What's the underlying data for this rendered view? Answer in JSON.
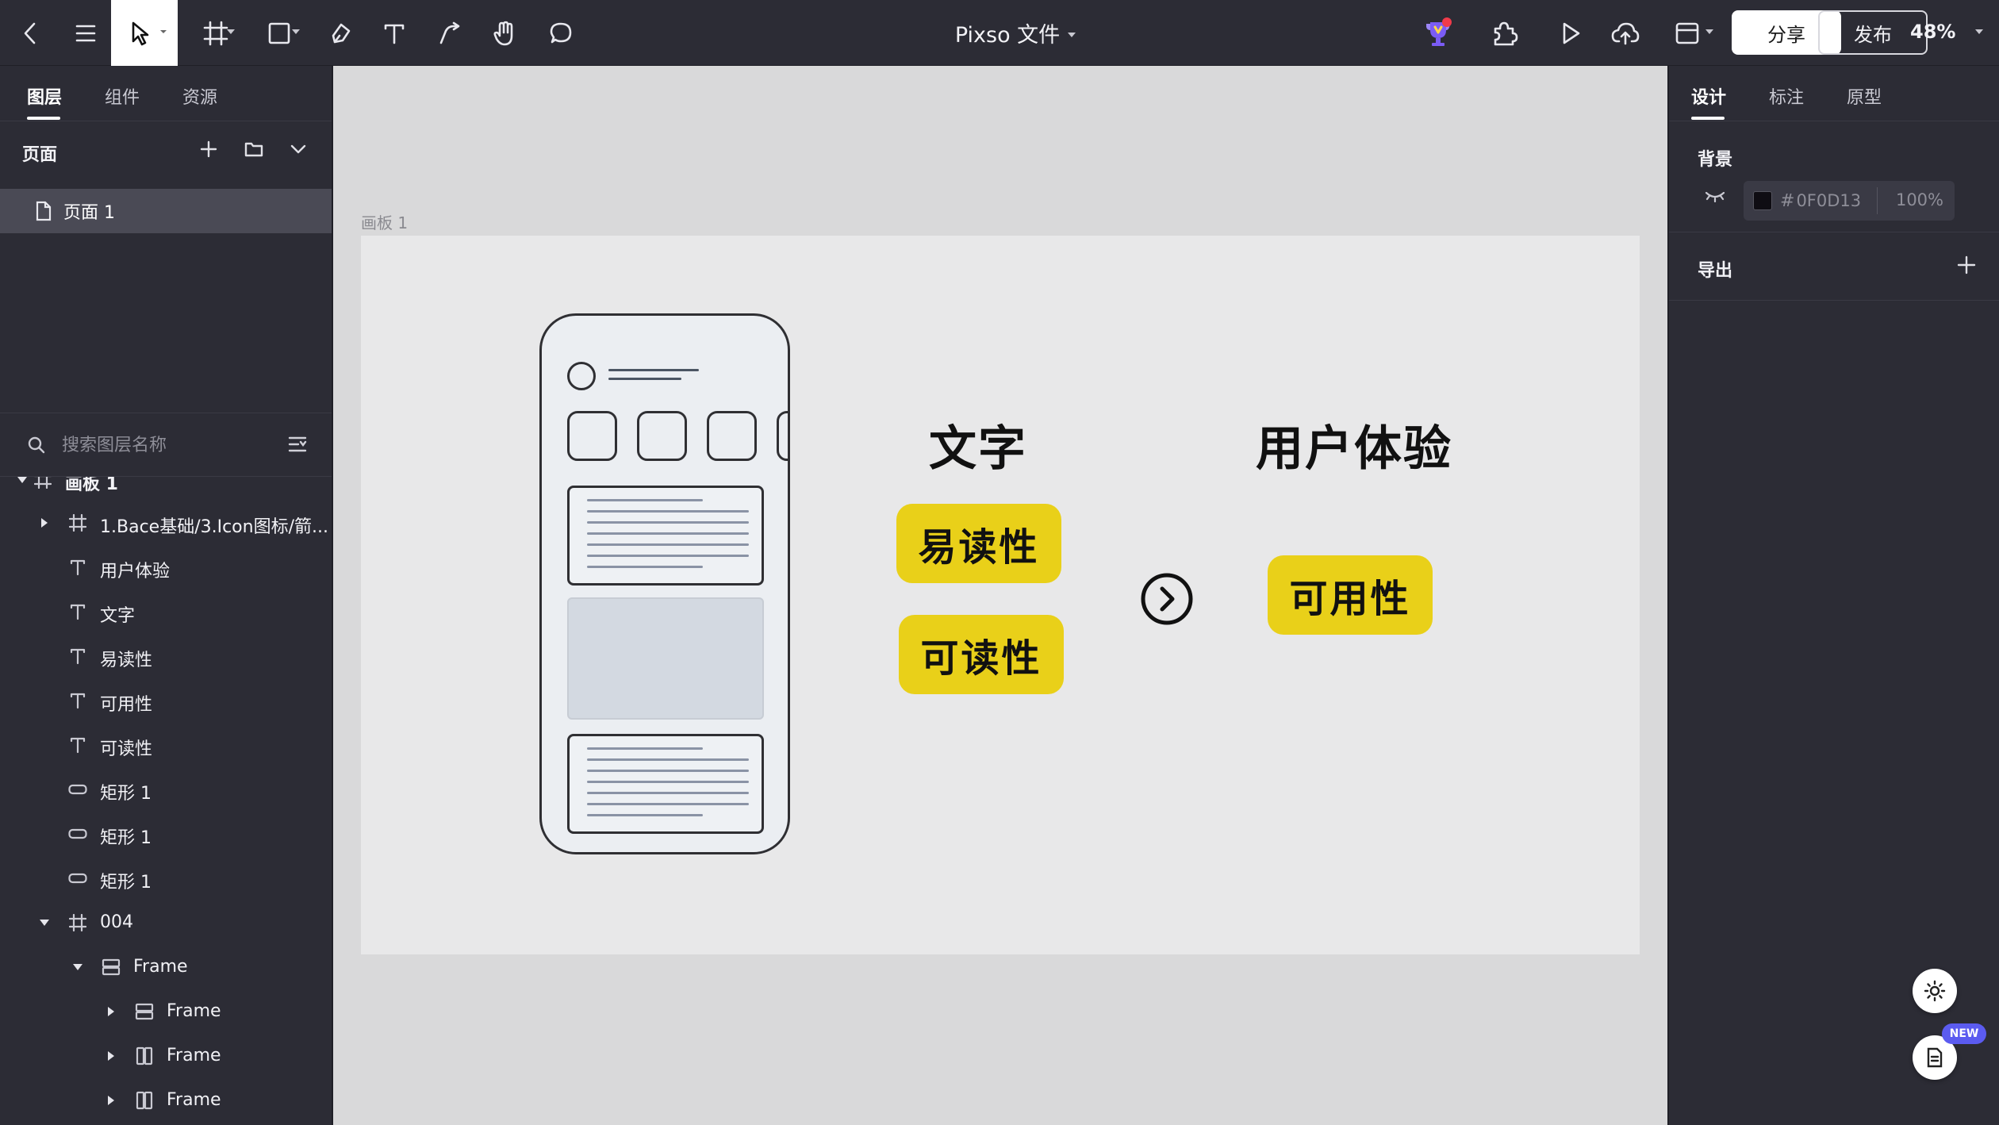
{
  "toolbar": {
    "document_title": "Pixso 文件",
    "share_label": "分享",
    "publish_label": "发布",
    "zoom": "48%"
  },
  "left_panel": {
    "tabs": [
      "图层",
      "组件",
      "资源"
    ],
    "pages_title": "页面",
    "pages": [
      "页面 1"
    ],
    "search_placeholder": "搜索图层名称",
    "layers": [
      {
        "name": "画板 1",
        "icon": "frame-icon"
      },
      {
        "name": "1.Bace基础/3.Icon图标/箭...",
        "icon": "frame-icon"
      },
      {
        "name": "用户体验",
        "icon": "text-icon"
      },
      {
        "name": "文字",
        "icon": "text-icon"
      },
      {
        "name": "易读性",
        "icon": "text-icon"
      },
      {
        "name": "可用性",
        "icon": "text-icon"
      },
      {
        "name": "可读性",
        "icon": "text-icon"
      },
      {
        "name": "矩形 1",
        "icon": "rectangle-icon"
      },
      {
        "name": "矩形 1",
        "icon": "rectangle-icon"
      },
      {
        "name": "矩形 1",
        "icon": "rectangle-icon"
      },
      {
        "name": "004",
        "icon": "frame-icon"
      },
      {
        "name": "Frame",
        "icon": "auto-layout-vertical-icon"
      },
      {
        "name": "Frame",
        "icon": "auto-layout-vertical-icon"
      },
      {
        "name": "Frame",
        "icon": "auto-layout-horizontal-icon"
      },
      {
        "name": "Frame",
        "icon": "auto-layout-horizontal-icon"
      }
    ]
  },
  "canvas": {
    "artboard_label": "画板 1",
    "heading_left": "文字",
    "heading_right": "用户体验",
    "pill_1": "易读性",
    "pill_2": "可读性",
    "pill_3": "可用性",
    "accent_color": "#E9D019"
  },
  "right_panel": {
    "tabs": [
      "设计",
      "标注",
      "原型"
    ],
    "background_title": "背景",
    "background_hash": "#",
    "background_hex": "0F0D13",
    "background_opacity": "100%",
    "export_title": "导出",
    "new_badge": "NEW"
  }
}
